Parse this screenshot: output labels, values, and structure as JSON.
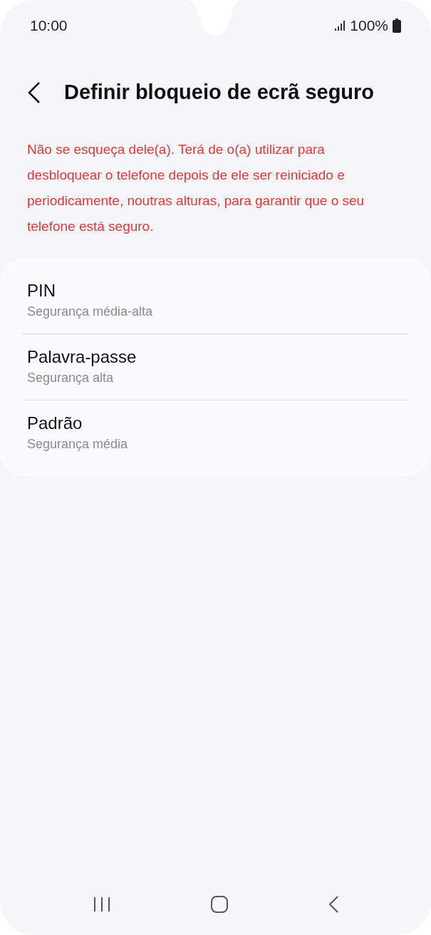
{
  "status_bar": {
    "time": "10:00",
    "battery": "100%"
  },
  "header": {
    "title": "Definir bloqueio de ecrã seguro"
  },
  "warning": "Não se esqueça dele(a). Terá de o(a) utilizar para desbloquear o telefone depois de ele ser reiniciado e periodicamente, noutras alturas, para garantir que o seu telefone está seguro.",
  "options": [
    {
      "title": "PIN",
      "subtitle": "Segurança média-alta"
    },
    {
      "title": "Palavra-passe",
      "subtitle": "Segurança alta"
    },
    {
      "title": "Padrão",
      "subtitle": "Segurança média"
    }
  ]
}
